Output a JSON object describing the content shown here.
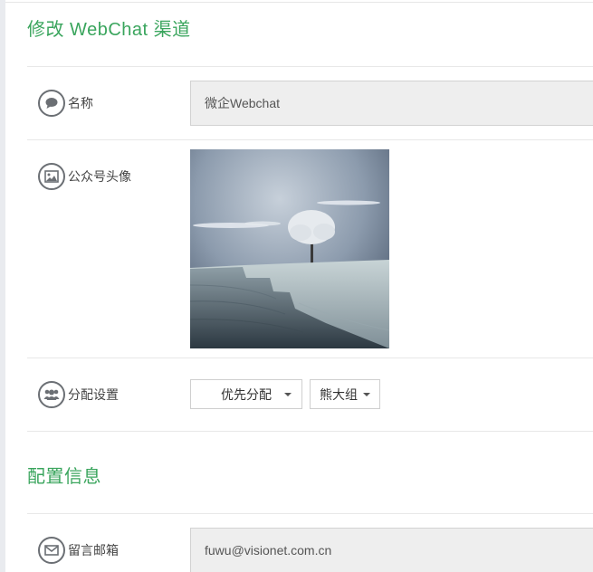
{
  "header": {
    "title": "修改 WebChat 渠道"
  },
  "fields": {
    "name": {
      "label": "名称",
      "value": "微企Webchat",
      "icon": "comment-icon"
    },
    "avatar": {
      "label": "公众号头像",
      "icon": "image-icon"
    },
    "assign": {
      "label": "分配设置",
      "icon": "users-icon",
      "strategy": "优先分配",
      "group": "熊大组"
    }
  },
  "config": {
    "title": "配置信息",
    "email": {
      "label": "留言邮箱",
      "value": "fuwu@visionet.com.cn",
      "icon": "envelope-icon"
    }
  },
  "colors": {
    "accent": "#3aa55d",
    "field_bg": "#eeeeee",
    "icon_stroke": "#6b6f74"
  }
}
